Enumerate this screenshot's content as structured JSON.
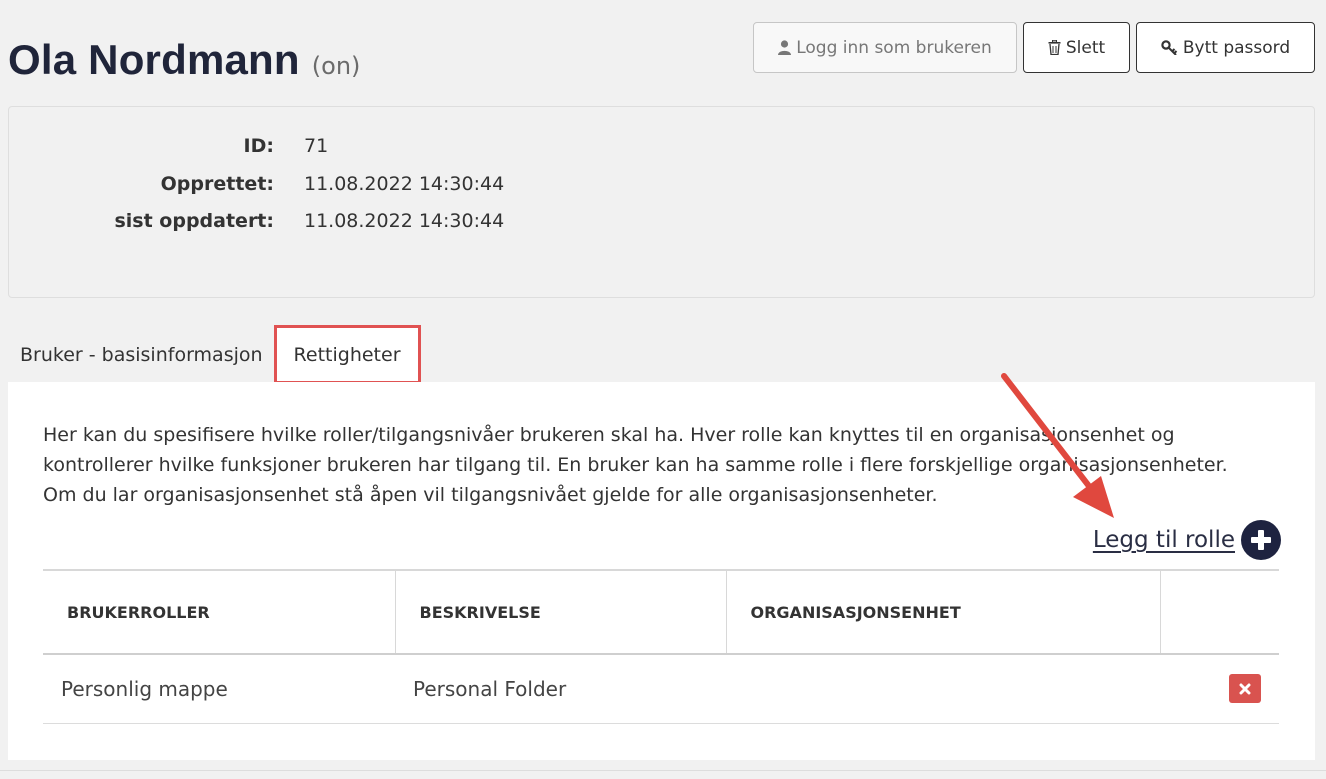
{
  "header": {
    "name": "Ola Nordmann",
    "username": "(on)",
    "actions": {
      "login_as_user": "Logg inn som brukeren",
      "delete": "Slett",
      "change_password": "Bytt passord"
    }
  },
  "info": {
    "id_label": "ID:",
    "id_value": "71",
    "created_label": "Opprettet:",
    "created_value": "11.08.2022 14:30:44",
    "updated_label": "sist oppdatert:",
    "updated_value": "11.08.2022 14:30:44"
  },
  "tabs": [
    {
      "label": "Bruker - basisinformasjon",
      "active": false
    },
    {
      "label": "Rettigheter",
      "active": true
    }
  ],
  "rights": {
    "intro_line1": "Her kan du spesifisere hvilke roller/tilgangsnivåer brukeren skal ha. Hver rolle kan knyttes til en organisasjonsenhet og",
    "intro_line2": "kontrollerer hvilke funksjoner brukeren har tilgang til. En bruker kan ha samme rolle i flere forskjellige organisasjonsenheter.",
    "intro_line3": "Om du lar organisasjonsenhet stå åpen vil tilgangsnivået gjelde for alle organisasjonsenheter.",
    "add_role_label": "Legg til rolle",
    "columns": [
      "BRUKERROLLER",
      "BESKRIVELSE",
      "ORGANISASJONSENHET",
      ""
    ],
    "rows": [
      {
        "role": "Personlig mappe",
        "description": "Personal Folder",
        "org_unit": ""
      }
    ]
  },
  "icons": {
    "login": "user-icon",
    "delete": "trash-icon",
    "password": "key-icon",
    "add": "plus-circle-icon",
    "remove": "close-icon"
  },
  "colors": {
    "highlight": "#e05252",
    "add_icon_bg": "#1e2340",
    "delete_bg": "#d9534f"
  }
}
